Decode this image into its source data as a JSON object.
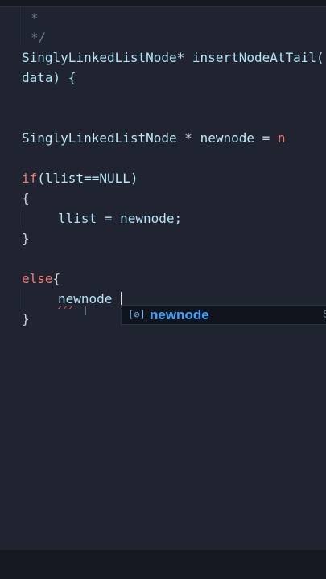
{
  "editor": {
    "comment_star": "*",
    "comment_end": "*/",
    "func_sig_line1": "SinglyLinkedListNode* insertNodeAtTail(",
    "func_sig_line2": "data) {",
    "decl_type": "SinglyLinkedListNode",
    "decl_star": " * ",
    "decl_name": "newnode",
    "decl_rest": " = ",
    "decl_new": "n",
    "if_kw": "if",
    "if_cond": "(llist==NULL)",
    "open_brace": "{",
    "assign_line": "llist = newnode;",
    "close_brace": "}",
    "else_kw": "else",
    "else_brace": "{",
    "typed_text": "newnode",
    "else_close": "}"
  },
  "suggest": {
    "icon_glyph": "[⊘]",
    "item_label": "newnode",
    "item_detail": "S"
  },
  "colors": {
    "background": "#1f2430",
    "keyword": "#f37a78",
    "identifier": "#bde8f5",
    "suggest_highlight": "#3da4ff"
  }
}
